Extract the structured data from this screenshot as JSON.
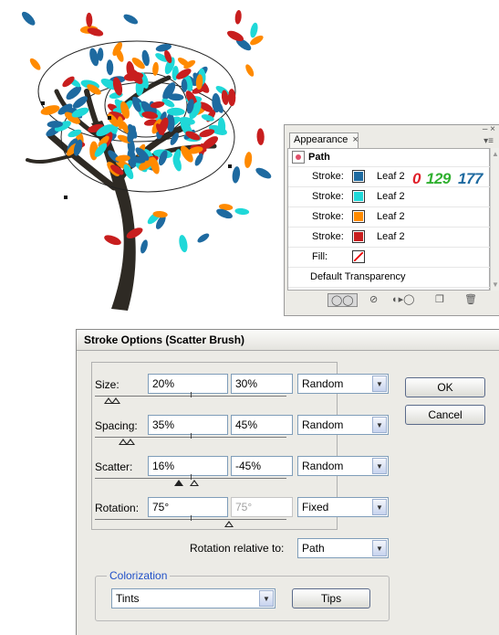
{
  "appearance_panel": {
    "tab_label": "Appearance",
    "tab_close": "×",
    "window_controls": "– ×",
    "menu_icon": "menu-icon",
    "path_label": "Path",
    "rows": [
      {
        "label": "Stroke:",
        "swatch": "#1e6aa0",
        "value": "Leaf 2"
      },
      {
        "label": "Stroke:",
        "swatch": "#1fd8d8",
        "value": "Leaf 2"
      },
      {
        "label": "Stroke:",
        "swatch": "#ff8a00",
        "value": "Leaf 2"
      },
      {
        "label": "Stroke:",
        "swatch": "#c81e1e",
        "value": "Leaf 2"
      },
      {
        "label": "Fill:",
        "swatch": "none",
        "value": ""
      },
      {
        "label": "Default Transparency",
        "swatch": "",
        "value": ""
      }
    ],
    "rgb_annotation": {
      "r": "0",
      "g": "129",
      "b": "177",
      "r_color": "#e0202a",
      "g_color": "#30b030",
      "b_color": "#1e6aa0"
    },
    "footer_icons": [
      "new-art-icon",
      "clear-icon",
      "reduce-basic-icon",
      "duplicate-icon",
      "delete-icon"
    ]
  },
  "dialog": {
    "title": "Stroke Options (Scatter Brush)",
    "rows": [
      {
        "label": "Size:",
        "value1": "20%",
        "value2": "30%",
        "method": "Random",
        "disabled2": false
      },
      {
        "label": "Spacing:",
        "value1": "35%",
        "value2": "45%",
        "method": "Random",
        "disabled2": false
      },
      {
        "label": "Scatter:",
        "value1": "16%",
        "value2": "-45%",
        "method": "Random",
        "disabled2": false
      },
      {
        "label": "Rotation:",
        "value1": "75°",
        "value2": "75°",
        "method": "Fixed",
        "disabled2": true
      }
    ],
    "ok_label": "OK",
    "cancel_label": "Cancel",
    "rotation_relative_label": "Rotation relative to:",
    "rotation_relative_value": "Path",
    "colorization": {
      "legend": "Colorization",
      "method": "Tints",
      "tips_label": "Tips"
    }
  },
  "colors": {
    "leaf_blue": "#1e6aa0",
    "leaf_cyan": "#1fd8d8",
    "leaf_orange": "#ff8a00",
    "leaf_red": "#c81e1e",
    "trunk": "#2e2a24",
    "accent_blue": "#2050c8"
  }
}
